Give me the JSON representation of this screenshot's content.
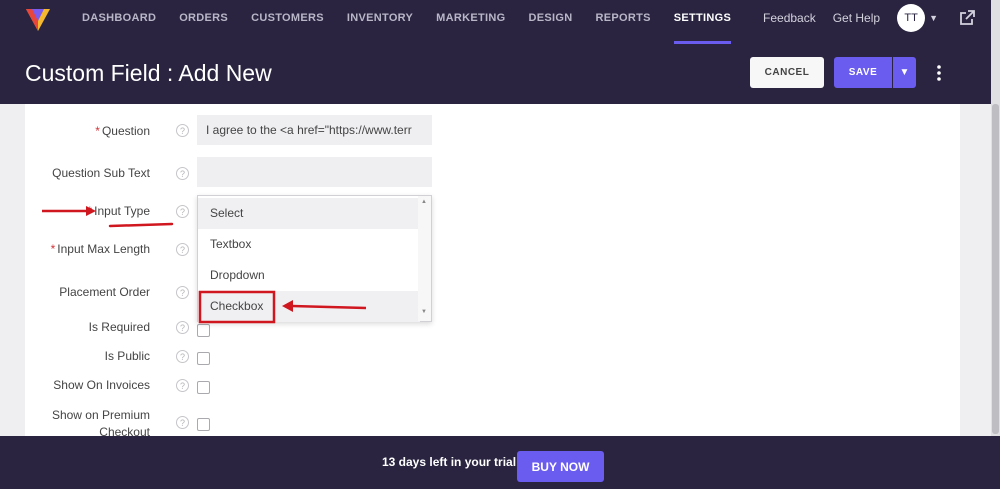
{
  "nav": {
    "items": [
      {
        "label": "DASHBOARD"
      },
      {
        "label": "ORDERS"
      },
      {
        "label": "CUSTOMERS"
      },
      {
        "label": "INVENTORY"
      },
      {
        "label": "MARKETING"
      },
      {
        "label": "DESIGN"
      },
      {
        "label": "REPORTS"
      },
      {
        "label": "SETTINGS",
        "active": true
      }
    ],
    "feedback": "Feedback",
    "help": "Get Help",
    "avatar_initials": "TT"
  },
  "page": {
    "title": "Custom Field : Add New",
    "cancel_label": "CANCEL",
    "save_label": "SAVE"
  },
  "form": {
    "required_mark": "*",
    "help_glyph": "?",
    "question": {
      "label": "Question",
      "value": "I agree to the <a href=\"https://www.terr"
    },
    "sub_text": {
      "label": "Question Sub Text",
      "value": ""
    },
    "input_type": {
      "label": "Input Type",
      "options": [
        "Select",
        "Textbox",
        "Dropdown",
        "Checkbox"
      ],
      "highlighted": "Checkbox"
    },
    "max_length": {
      "label": "Input Max Length"
    },
    "placement_order": {
      "label": "Placement Order"
    },
    "is_required": {
      "label": "Is Required"
    },
    "is_public": {
      "label": "Is Public"
    },
    "show_invoices": {
      "label": "Show On Invoices"
    },
    "show_premium": {
      "label_line1": "Show on Premium",
      "label_line2": "Checkout"
    }
  },
  "footer": {
    "trial_text": "13 days left in your trial",
    "buy_label": "BUY NOW"
  },
  "colors": {
    "header_bg": "#2a2440",
    "accent": "#6b5cf0",
    "annotation": "#d0161e"
  }
}
